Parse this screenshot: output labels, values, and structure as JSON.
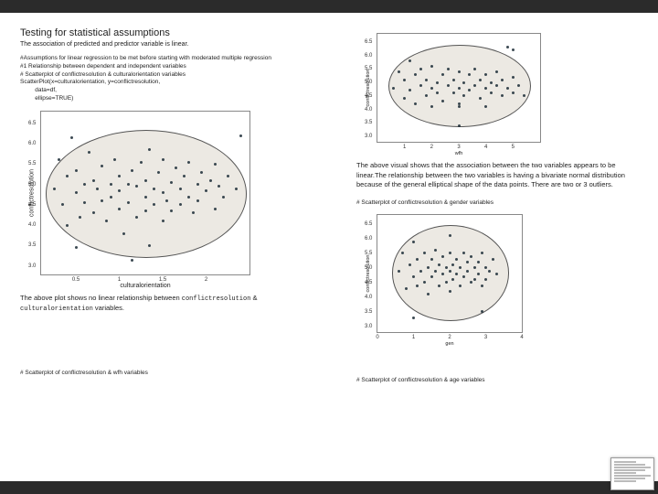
{
  "heading": "Testing for statistical assumptions",
  "sub": "The association of predicted and predictor variable is linear.",
  "code1": "#Assumptions for linear regression to be met before starting with moderated multiple regression\n#1 Relationship between dependent and independent variables\n# Scatterplot of conflictresolution & culturalorientation variables\nScatterPlot(x=culturalorientation, y=conflictresolution,\n         data=df,\n         ellipse=TRUE)",
  "caption1_a": "The above plot shows no linear relationship between ",
  "caption1_b": "conflictresolution",
  "caption1_c": " & ",
  "caption1_d": "culturalorientation",
  "caption1_e": " variables.",
  "code2": "# Scatterplot of conflictresolution & wfh variables",
  "caption2": "The above visual shows that the association between the two variables appears to be linear.The relationship between the two variables is having a bivariate normal distribution because of the general elliptical shape of the data points. There are two or 3 outliers.",
  "code3": "# Scatterplot of conflictresolution & gender variables",
  "code4": "# Scatterplot of conflictresolution & age variables",
  "chart_data": [
    {
      "type": "scatter",
      "title": "",
      "xlabel": "culturalorientation",
      "ylabel": "conflictresolution",
      "xlim": [
        0.1,
        2.5
      ],
      "ylim": [
        2.8,
        6.8
      ],
      "xticks": [
        0.5,
        1.0,
        1.5,
        2.0
      ],
      "yticks": [
        3.0,
        3.5,
        4.0,
        4.5,
        5.0,
        5.5,
        6.0,
        6.5
      ],
      "ellipse": {
        "cx": 1.3,
        "cy": 4.8,
        "rx": 1.15,
        "ry": 1.55
      },
      "points": [
        [
          0.25,
          4.9
        ],
        [
          0.3,
          5.6
        ],
        [
          0.35,
          4.5
        ],
        [
          0.4,
          5.2
        ],
        [
          0.4,
          4.0
        ],
        [
          0.45,
          6.15
        ],
        [
          0.5,
          4.8
        ],
        [
          0.5,
          5.35
        ],
        [
          0.55,
          4.2
        ],
        [
          0.6,
          5.0
        ],
        [
          0.6,
          4.55
        ],
        [
          0.65,
          5.8
        ],
        [
          0.7,
          4.3
        ],
        [
          0.7,
          5.1
        ],
        [
          0.75,
          4.9
        ],
        [
          0.8,
          4.6
        ],
        [
          0.8,
          5.45
        ],
        [
          0.85,
          4.1
        ],
        [
          0.9,
          5.0
        ],
        [
          0.9,
          4.7
        ],
        [
          0.95,
          5.6
        ],
        [
          1.0,
          4.4
        ],
        [
          1.0,
          5.2
        ],
        [
          1.0,
          4.85
        ],
        [
          1.05,
          3.8
        ],
        [
          1.1,
          5.0
        ],
        [
          1.1,
          4.55
        ],
        [
          1.15,
          5.35
        ],
        [
          1.2,
          4.2
        ],
        [
          1.2,
          4.95
        ],
        [
          1.25,
          5.55
        ],
        [
          1.3,
          4.7
        ],
        [
          1.3,
          5.1
        ],
        [
          1.3,
          4.35
        ],
        [
          1.35,
          5.85
        ],
        [
          1.35,
          3.5
        ],
        [
          1.4,
          4.9
        ],
        [
          1.4,
          4.5
        ],
        [
          1.45,
          5.3
        ],
        [
          1.5,
          4.1
        ],
        [
          1.5,
          4.8
        ],
        [
          1.5,
          5.6
        ],
        [
          1.55,
          4.6
        ],
        [
          1.6,
          5.05
        ],
        [
          1.6,
          4.35
        ],
        [
          1.65,
          5.4
        ],
        [
          1.7,
          4.9
        ],
        [
          1.7,
          4.5
        ],
        [
          1.75,
          5.2
        ],
        [
          1.8,
          4.7
        ],
        [
          1.8,
          5.55
        ],
        [
          1.85,
          4.3
        ],
        [
          1.9,
          5.0
        ],
        [
          1.9,
          4.6
        ],
        [
          1.95,
          5.3
        ],
        [
          2.0,
          4.85
        ],
        [
          2.05,
          5.1
        ],
        [
          2.1,
          4.4
        ],
        [
          2.1,
          5.5
        ],
        [
          2.15,
          4.95
        ],
        [
          2.2,
          4.7
        ],
        [
          2.25,
          5.2
        ],
        [
          2.35,
          4.9
        ],
        [
          2.4,
          6.2
        ],
        [
          0.5,
          3.45
        ],
        [
          1.15,
          3.15
        ]
      ]
    },
    {
      "type": "scatter",
      "title": "",
      "xlabel": "wfh",
      "ylabel": "conflictresolution",
      "xlim": [
        0,
        6
      ],
      "ylim": [
        2.8,
        6.8
      ],
      "xticks": [
        1,
        2,
        3,
        4,
        5
      ],
      "yticks": [
        3.0,
        3.5,
        4.0,
        4.5,
        5.0,
        5.5,
        6.0,
        6.5
      ],
      "ellipse": {
        "cx": 3.0,
        "cy": 4.9,
        "rx": 2.6,
        "ry": 1.5
      },
      "points": [
        [
          0.6,
          4.8
        ],
        [
          0.8,
          5.4
        ],
        [
          1.0,
          4.4
        ],
        [
          1.0,
          5.1
        ],
        [
          1.2,
          5.8
        ],
        [
          1.2,
          4.7
        ],
        [
          1.4,
          5.3
        ],
        [
          1.4,
          4.2
        ],
        [
          1.6,
          4.9
        ],
        [
          1.6,
          5.5
        ],
        [
          1.8,
          4.5
        ],
        [
          1.8,
          5.1
        ],
        [
          2.0,
          4.8
        ],
        [
          2.0,
          5.6
        ],
        [
          2.0,
          4.1
        ],
        [
          2.2,
          5.0
        ],
        [
          2.2,
          4.6
        ],
        [
          2.4,
          5.3
        ],
        [
          2.4,
          4.3
        ],
        [
          2.6,
          4.9
        ],
        [
          2.6,
          5.5
        ],
        [
          2.8,
          4.6
        ],
        [
          2.8,
          5.1
        ],
        [
          3.0,
          4.8
        ],
        [
          3.0,
          5.4
        ],
        [
          3.0,
          4.2
        ],
        [
          3.0,
          4.1
        ],
        [
          3.0,
          3.4
        ],
        [
          3.2,
          5.0
        ],
        [
          3.2,
          4.5
        ],
        [
          3.4,
          5.3
        ],
        [
          3.4,
          4.7
        ],
        [
          3.6,
          4.9
        ],
        [
          3.6,
          5.5
        ],
        [
          3.8,
          4.4
        ],
        [
          3.8,
          5.1
        ],
        [
          4.0,
          4.8
        ],
        [
          4.0,
          5.3
        ],
        [
          4.0,
          4.1
        ],
        [
          4.2,
          4.6
        ],
        [
          4.2,
          5.0
        ],
        [
          4.4,
          4.9
        ],
        [
          4.4,
          5.4
        ],
        [
          4.6,
          4.5
        ],
        [
          4.6,
          5.1
        ],
        [
          4.8,
          4.8
        ],
        [
          5.0,
          4.6
        ],
        [
          5.0,
          5.2
        ],
        [
          5.2,
          4.9
        ],
        [
          5.4,
          4.5
        ],
        [
          5.0,
          6.2
        ],
        [
          4.8,
          6.3
        ]
      ]
    },
    {
      "type": "scatter",
      "title": "",
      "xlabel": "gen",
      "ylabel": "conflictresolution",
      "xlim": [
        0,
        4
      ],
      "ylim": [
        2.8,
        6.8
      ],
      "xticks": [
        0,
        1,
        2,
        3,
        4
      ],
      "yticks": [
        3.0,
        3.5,
        4.0,
        4.5,
        5.0,
        5.5,
        6.0,
        6.5
      ],
      "ellipse": {
        "cx": 2.0,
        "cy": 4.85,
        "rx": 1.6,
        "ry": 1.6
      },
      "points": [
        [
          0.6,
          4.9
        ],
        [
          0.7,
          5.5
        ],
        [
          0.8,
          4.3
        ],
        [
          0.9,
          5.1
        ],
        [
          1.0,
          4.7
        ],
        [
          1.0,
          5.9
        ],
        [
          1.1,
          4.4
        ],
        [
          1.1,
          5.3
        ],
        [
          1.2,
          4.9
        ],
        [
          1.3,
          4.5
        ],
        [
          1.3,
          5.5
        ],
        [
          1.4,
          5.0
        ],
        [
          1.4,
          4.1
        ],
        [
          1.5,
          5.3
        ],
        [
          1.5,
          4.7
        ],
        [
          1.6,
          4.9
        ],
        [
          1.6,
          5.6
        ],
        [
          1.7,
          4.4
        ],
        [
          1.7,
          5.1
        ],
        [
          1.8,
          4.8
        ],
        [
          1.8,
          5.4
        ],
        [
          1.9,
          4.5
        ],
        [
          1.9,
          5.0
        ],
        [
          2.0,
          4.9
        ],
        [
          2.0,
          5.5
        ],
        [
          2.0,
          4.2
        ],
        [
          2.0,
          6.1
        ],
        [
          2.1,
          5.1
        ],
        [
          2.1,
          4.6
        ],
        [
          2.2,
          5.3
        ],
        [
          2.2,
          4.8
        ],
        [
          2.3,
          4.4
        ],
        [
          2.3,
          5.0
        ],
        [
          2.4,
          5.5
        ],
        [
          2.4,
          4.7
        ],
        [
          2.5,
          4.9
        ],
        [
          2.5,
          5.2
        ],
        [
          2.6,
          4.5
        ],
        [
          2.6,
          5.4
        ],
        [
          2.7,
          5.0
        ],
        [
          2.7,
          4.6
        ],
        [
          2.8,
          5.2
        ],
        [
          2.8,
          4.8
        ],
        [
          2.9,
          4.4
        ],
        [
          2.9,
          5.5
        ],
        [
          3.0,
          5.0
        ],
        [
          3.0,
          4.6
        ],
        [
          3.1,
          4.9
        ],
        [
          3.2,
          5.3
        ],
        [
          3.3,
          4.8
        ],
        [
          1.0,
          3.3
        ],
        [
          2.9,
          3.5
        ]
      ]
    }
  ]
}
